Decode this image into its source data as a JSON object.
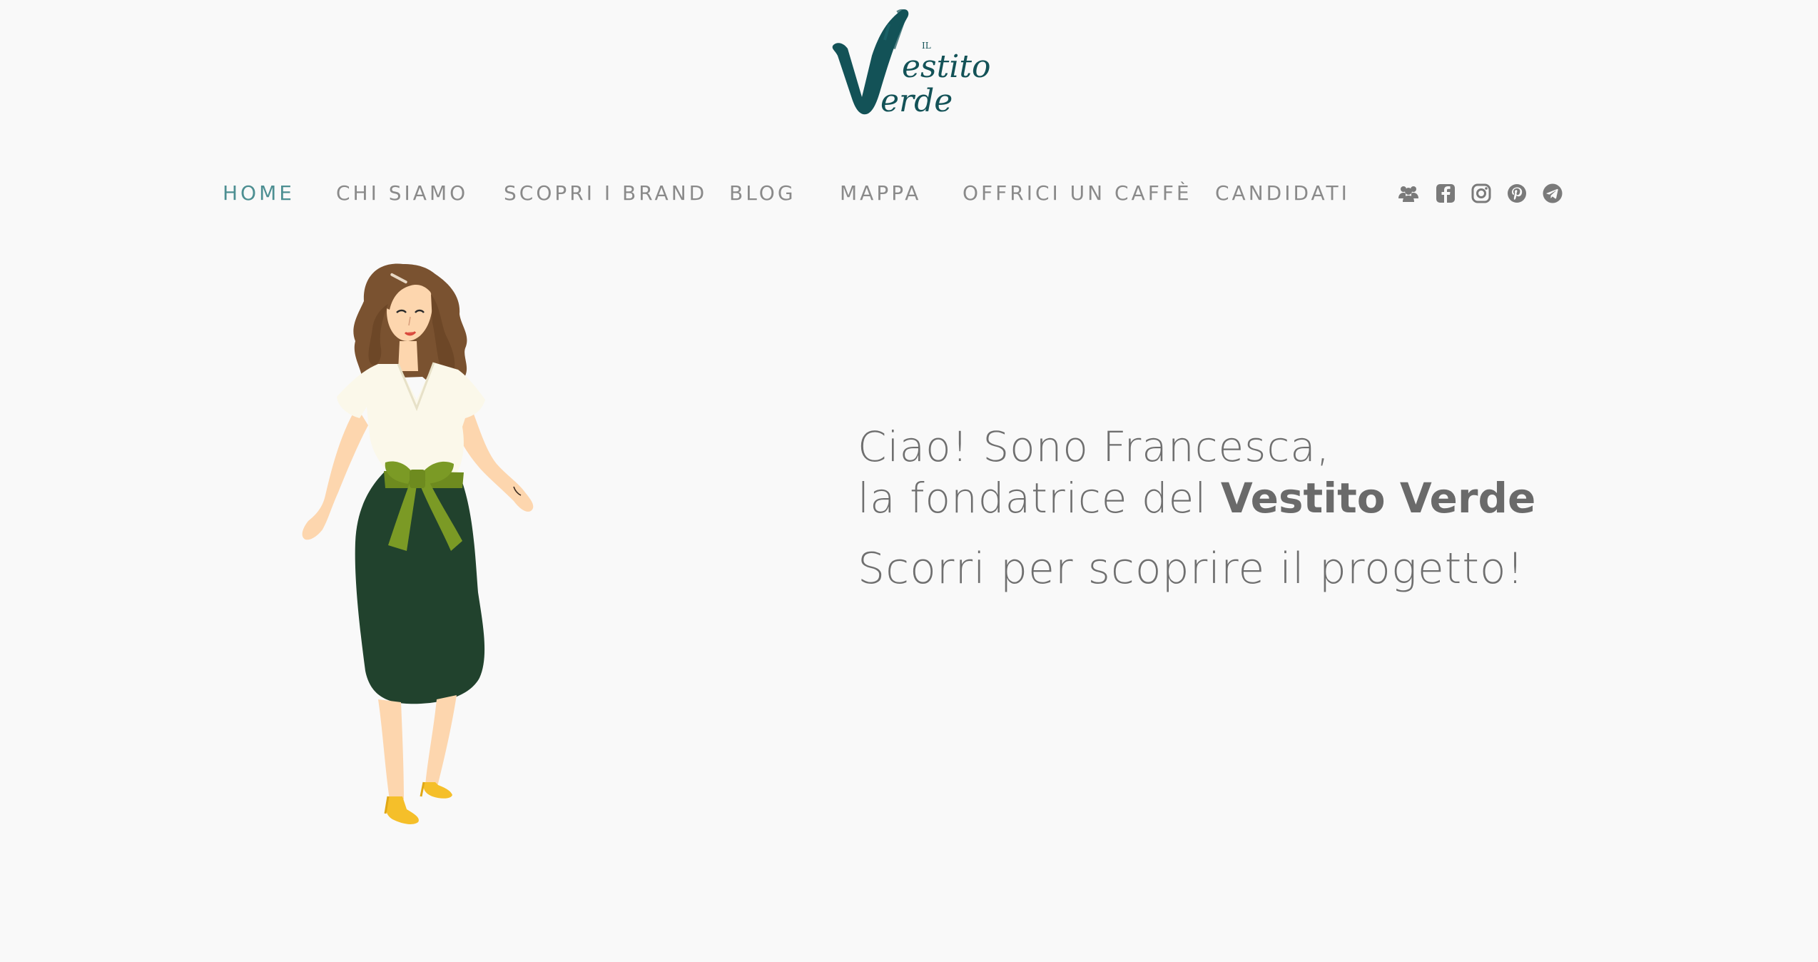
{
  "brand": {
    "logo_small": "IL",
    "logo_word1": "estito",
    "logo_word2": "erde",
    "color": "#135257"
  },
  "nav": {
    "items": [
      {
        "label": "HOME",
        "active": true
      },
      {
        "label": "CHI SIAMO",
        "active": false
      },
      {
        "label": "SCOPRI I BRAND",
        "active": false
      },
      {
        "label": "BLOG",
        "active": false
      },
      {
        "label": "MAPPA",
        "active": false
      },
      {
        "label": "OFFRICI UN CAFFÈ",
        "active": false
      },
      {
        "label": "CANDIDATI",
        "active": false
      }
    ],
    "active_color": "#4d8f92",
    "color": "#8a8a8a"
  },
  "social": [
    {
      "icon": "users-icon"
    },
    {
      "icon": "facebook-icon"
    },
    {
      "icon": "instagram-icon"
    },
    {
      "icon": "pinterest-icon"
    },
    {
      "icon": "telegram-icon"
    }
  ],
  "hero": {
    "line1": "Ciao! Sono Francesca,",
    "line2_prefix": "la fondatrice del ",
    "line2_brand": "Vestito Verde",
    "cta": "Scorri per scoprire il progetto!"
  },
  "colors": {
    "background": "#f9f9f9",
    "text": "#6f6f6f",
    "skirt": "#21422d",
    "sash": "#7b9a25",
    "shoes": "#f5bf2a",
    "hair": "#7a5230"
  }
}
